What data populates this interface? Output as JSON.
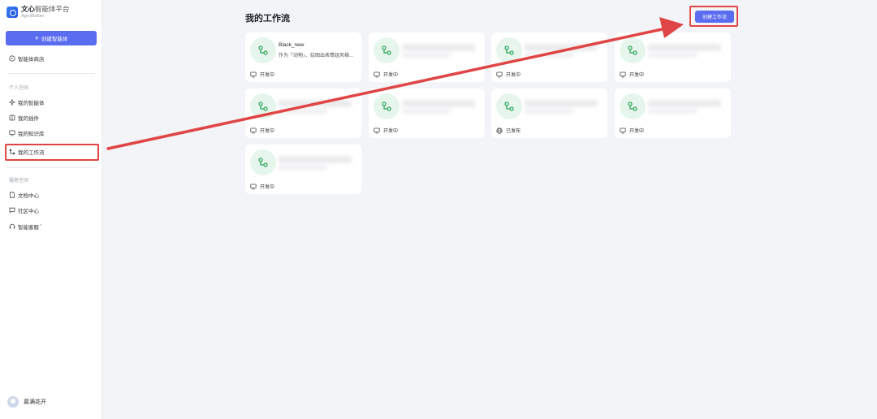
{
  "brand": {
    "title_bold": "文心",
    "title_light": "智能体平台",
    "subtitle": "AgentBuilder"
  },
  "sidebar": {
    "create_button": "创建智能体",
    "store": "智能体商店",
    "personal_section": "个人空间",
    "personal_items": [
      {
        "label": "我的智能体",
        "icon": "sparkle-icon"
      },
      {
        "label": "我的插件",
        "icon": "plugin-icon"
      },
      {
        "label": "我的知识库",
        "icon": "monitor-icon"
      },
      {
        "label": "我的工作流",
        "icon": "workflow-icon"
      }
    ],
    "service_section": "服务空间",
    "service_items": [
      {
        "label": "文档中心",
        "icon": "document-icon"
      },
      {
        "label": "社区中心",
        "icon": "chat-icon"
      },
      {
        "label": "智能客服",
        "icon": "headset-icon",
        "badge": "*"
      }
    ],
    "user_name": "慕满花开"
  },
  "main": {
    "title": "我的工作流",
    "create_button": "创建工作流",
    "cards": [
      {
        "name": "Black_new",
        "description": "作为「动物」、绘图出表情组风格...",
        "status": "开发中",
        "status_icon": "monitor-icon"
      },
      {
        "name": "",
        "description": "",
        "status": "开发中",
        "status_icon": "monitor-icon"
      },
      {
        "name": "",
        "description": "",
        "status": "开发中",
        "status_icon": "monitor-icon"
      },
      {
        "name": "",
        "description": "",
        "status": "开发中",
        "status_icon": "monitor-icon"
      },
      {
        "name": "",
        "description": "",
        "status": "开发中",
        "status_icon": "monitor-icon"
      },
      {
        "name": "",
        "description": "",
        "status": "开发中",
        "status_icon": "monitor-icon"
      },
      {
        "name": "",
        "description": "",
        "status": "已发布",
        "status_icon": "globe-icon"
      },
      {
        "name": "",
        "description": "",
        "status": "开发中",
        "status_icon": "monitor-icon"
      },
      {
        "name": "",
        "description": "",
        "status": "开发中",
        "status_icon": "monitor-icon"
      }
    ]
  },
  "colors": {
    "accent": "#5a6cf0",
    "annotation": "#e04545",
    "icon_bg": "#e6f6ec",
    "icon_fg": "#2fa760"
  }
}
